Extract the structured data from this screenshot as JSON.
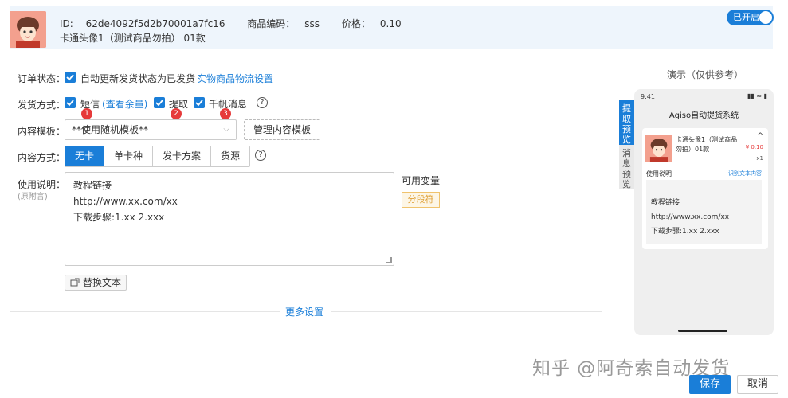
{
  "header": {
    "id_label": "ID:",
    "id_value": "62de4092f5d2b70001a7fc16",
    "code_label": "商品编码：",
    "code_value": "sss",
    "price_label": "价格：",
    "price_value": "0.10",
    "product_name": "卡通头像1（测试商品勿拍）",
    "product_count": "01款",
    "toggle_label": "已开启"
  },
  "form": {
    "order_status_label": "订单状态：",
    "order_status_checkbox": "自动更新发货状态为已发货",
    "order_status_link": "实物商品物流设置",
    "delivery_label": "发货方式：",
    "delivery_options": [
      {
        "label": "短信",
        "badge": "1"
      },
      {
        "label": "提取",
        "badge": "2"
      },
      {
        "label": "千帆消息",
        "badge": "3"
      }
    ],
    "sms_quota_link": "(查看余量)",
    "template_label": "内容模板：",
    "template_value": "**使用随机模板**",
    "manage_template_button": "管理内容模板",
    "content_mode_label": "内容方式：",
    "content_modes": [
      "无卡",
      "单卡种",
      "发卡方案",
      "货源"
    ],
    "active_mode": "无卡",
    "usage_label": "使用说明：",
    "usage_sub_label": "(原附言)",
    "usage_lines": [
      "教程链接",
      "http://www.xx.com/xx",
      "下载步骤:1.xx 2.xxx"
    ],
    "variables_label": "可用变量",
    "variable_tag": "分段符",
    "replace_button": "替换文本",
    "more_settings": "更多设置"
  },
  "preview": {
    "title": "演示（仅供参考）",
    "tabs": [
      {
        "label": "提取预览",
        "active": true
      },
      {
        "label": "消息预览",
        "active": false
      }
    ],
    "time": "9:41",
    "app_title": "Agiso自动提货系统",
    "product_name": "卡通头像1（测试商品勿拍）01款",
    "price": "¥ 0.10",
    "qty": "x1",
    "usage_label": "使用说明",
    "usage_link": "识别文本内容",
    "usage_lines": [
      "教程链接",
      "http://www.xx.com/xx",
      "下载步骤:1.xx 2.xxx"
    ]
  },
  "footer": {
    "watermark": "知乎 @阿奇索自动发货",
    "save_button": "保存",
    "cancel_button": "取消"
  },
  "colors": {
    "accent": "#1a7ed8",
    "badge_red": "#e63a3a",
    "header_bg": "#eef5fc",
    "tag_border": "#f0c36d"
  }
}
